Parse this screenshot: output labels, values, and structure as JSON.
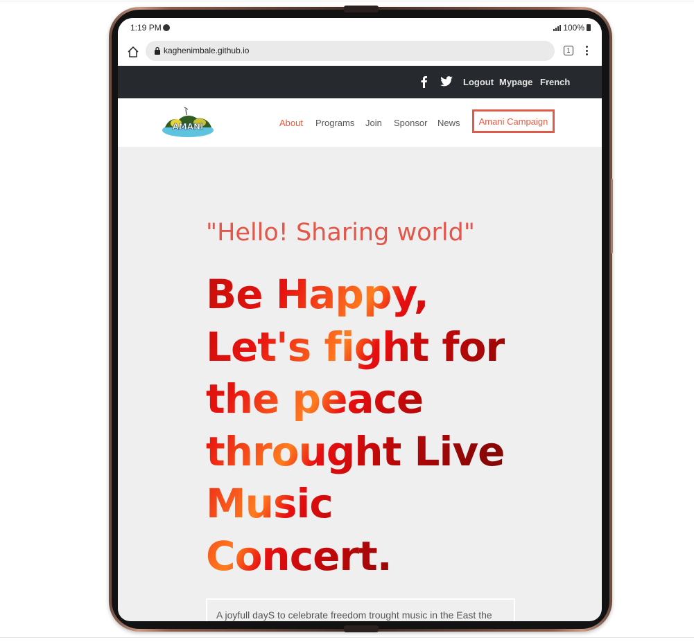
{
  "status_bar": {
    "time": "1:19 PM",
    "battery": "100%"
  },
  "browser": {
    "url": "kaghenimbale.github.io",
    "tab_count": "1"
  },
  "top_bar": {
    "links": [
      {
        "label": "Logout"
      },
      {
        "label": "Mypage"
      },
      {
        "label": "French"
      }
    ],
    "social_icons": [
      "facebook-icon",
      "twitter-icon"
    ]
  },
  "nav": {
    "logo_text": "AMANI",
    "items": [
      {
        "label": "About",
        "active": true
      },
      {
        "label": "Programs"
      },
      {
        "label": "Join"
      },
      {
        "label": "Sponsor"
      },
      {
        "label": "News"
      },
      {
        "label": "Amani Campaign",
        "highlighted": true
      }
    ]
  },
  "hero": {
    "subtitle": "\"Hello! Sharing world\"",
    "title_lines": [
      "Be Happy,",
      "Let's fight for",
      "the peace",
      "throught Live",
      "Music",
      "Concert."
    ],
    "description": "A joyfull dayS to celebrate freedom trought music in the East the"
  },
  "colors": {
    "accent": "#e8583f",
    "topbar_bg": "#26292e",
    "page_bg": "#efefef",
    "title_dark": "#8e0606",
    "title_orange": "#ff7d1f"
  }
}
